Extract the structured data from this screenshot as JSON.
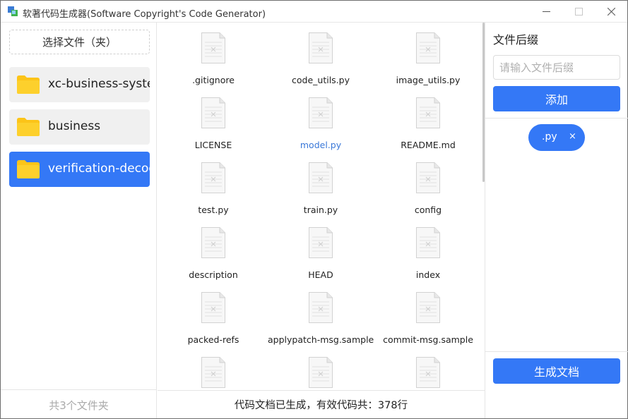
{
  "window": {
    "title": "软著代码生成器(Software Copyright's Code Generator)"
  },
  "left": {
    "choose_label": "选择文件（夹）",
    "folders": [
      {
        "name": "xc-business-system",
        "active": false
      },
      {
        "name": "business",
        "active": false
      },
      {
        "name": "verification-decode",
        "active": true
      }
    ],
    "count_label": "共3个文件夹"
  },
  "files": [
    {
      "name": ".gitignore"
    },
    {
      "name": "code_utils.py"
    },
    {
      "name": "image_utils.py"
    },
    {
      "name": "LICENSE"
    },
    {
      "name": "model.py"
    },
    {
      "name": "README.md"
    },
    {
      "name": "test.py"
    },
    {
      "name": "train.py"
    },
    {
      "name": "config"
    },
    {
      "name": "description"
    },
    {
      "name": "HEAD"
    },
    {
      "name": "index"
    },
    {
      "name": "packed-refs"
    },
    {
      "name": "applypatch-msg.sample"
    },
    {
      "name": "commit-msg.sample"
    },
    {
      "name": ""
    },
    {
      "name": ""
    },
    {
      "name": ""
    }
  ],
  "status": {
    "text": "代码文档已生成，有效代码共：378行"
  },
  "right": {
    "suffix_title": "文件后缀",
    "suffix_placeholder": "请输入文件后缀",
    "add_label": "添加",
    "tags": [
      ".py"
    ],
    "tag_close": "×",
    "generate_label": "生成文档"
  },
  "colors": {
    "accent": "#3478f6",
    "folder": "#fcc418",
    "link": "#3a78d8"
  }
}
